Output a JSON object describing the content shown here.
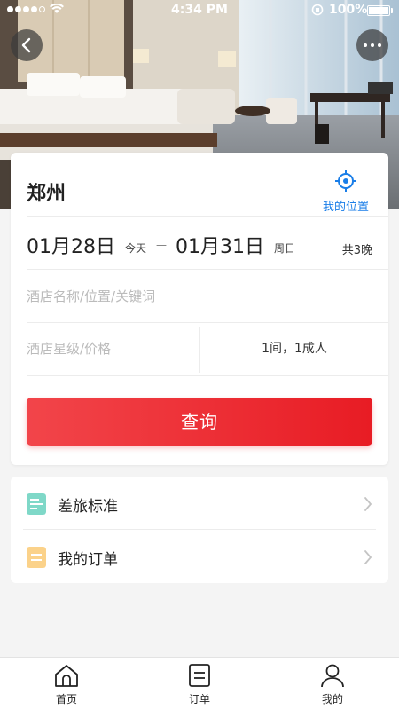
{
  "status_bar": {
    "time": "4:34 PM",
    "battery": "100%"
  },
  "header": {
    "back_icon": "chevron-left-icon",
    "more_icon": "more-dots-icon"
  },
  "search_card": {
    "city": "郑州",
    "locate_label": "我的位置",
    "locate_icon": "crosshair-location-icon",
    "checkin_date": "01月28日",
    "checkin_day": "今天",
    "separator": "—",
    "checkout_date": "01月31日",
    "checkout_day": "周日",
    "nights": "共3晚",
    "keyword_placeholder": "酒店名称/位置/关键词",
    "star_price_placeholder": "酒店星级/价格",
    "rooms_guests": "1间，1成人",
    "query_button": "查询"
  },
  "menu": {
    "items": [
      {
        "label": "差旅标准",
        "icon": "document-icon",
        "color": "#7fd8c8"
      },
      {
        "label": "我的订单",
        "icon": "order-list-icon",
        "color": "#fbd28a"
      }
    ]
  },
  "tabbar": {
    "tabs": [
      {
        "label": "首页",
        "icon": "home-icon"
      },
      {
        "label": "订单",
        "icon": "order-icon"
      },
      {
        "label": "我的",
        "icon": "user-icon"
      }
    ]
  },
  "colors": {
    "accent_red": "#e81c24",
    "link_blue": "#1a7ee8"
  }
}
